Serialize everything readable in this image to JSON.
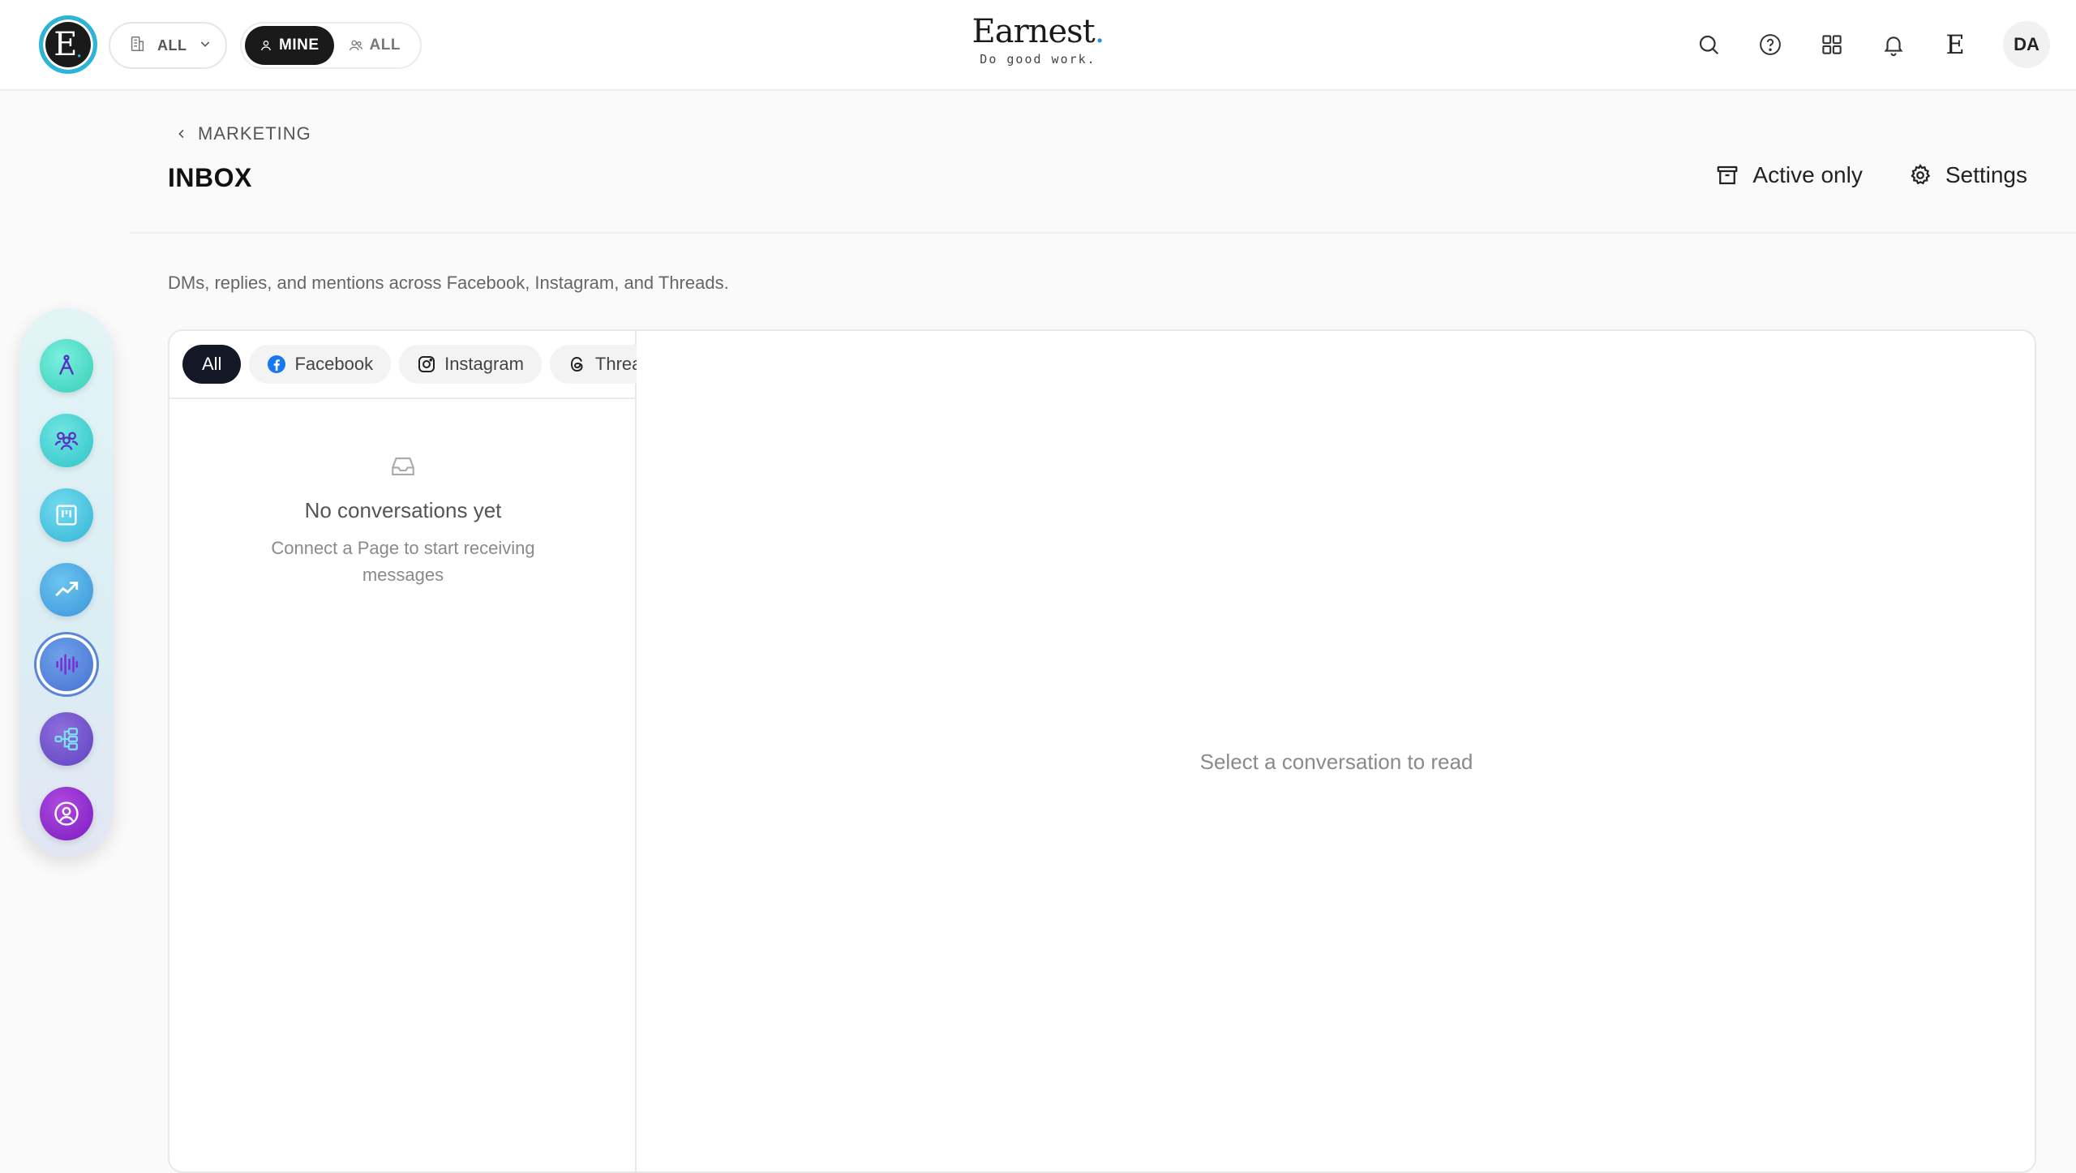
{
  "topbar": {
    "logo_letter": "E",
    "org_select_label": "ALL",
    "scope": {
      "mine_label": "MINE",
      "all_label": "ALL",
      "selected": "MINE"
    },
    "brand_name": "Earnest",
    "brand_tagline": "Do good work.",
    "app_mark": "E",
    "avatar_initials": "DA",
    "icons": [
      "search-icon",
      "help-icon",
      "apps-grid-icon",
      "bell-icon"
    ]
  },
  "rail": {
    "items": [
      {
        "name": "compass-icon",
        "color": "#3fd3c0"
      },
      {
        "name": "people-icon",
        "color": "#2fc6c9"
      },
      {
        "name": "board-icon",
        "color": "#35b7d8"
      },
      {
        "name": "trend-icon",
        "color": "#3d98db"
      },
      {
        "name": "audio-wave-icon",
        "color": "#4b77d4",
        "active": true
      },
      {
        "name": "workflow-icon",
        "color": "#6b4fc8"
      },
      {
        "name": "account-icon",
        "color": "#8a26c6"
      }
    ]
  },
  "breadcrumb": {
    "label": "MARKETING"
  },
  "page": {
    "title": "INBOX",
    "description": "DMs, replies, and mentions across Facebook, Instagram, and Threads."
  },
  "actions": {
    "active_only": "Active only",
    "settings": "Settings"
  },
  "filters": {
    "items": [
      {
        "label": "All",
        "active": true
      },
      {
        "label": "Facebook",
        "icon": "facebook-icon"
      },
      {
        "label": "Instagram",
        "icon": "instagram-icon"
      },
      {
        "label": "Threads",
        "icon": "threads-icon"
      }
    ]
  },
  "empty_state": {
    "title": "No conversations yet",
    "subtitle": "Connect a Page to start receiving messages"
  },
  "reader": {
    "placeholder": "Select a conversation to read"
  }
}
